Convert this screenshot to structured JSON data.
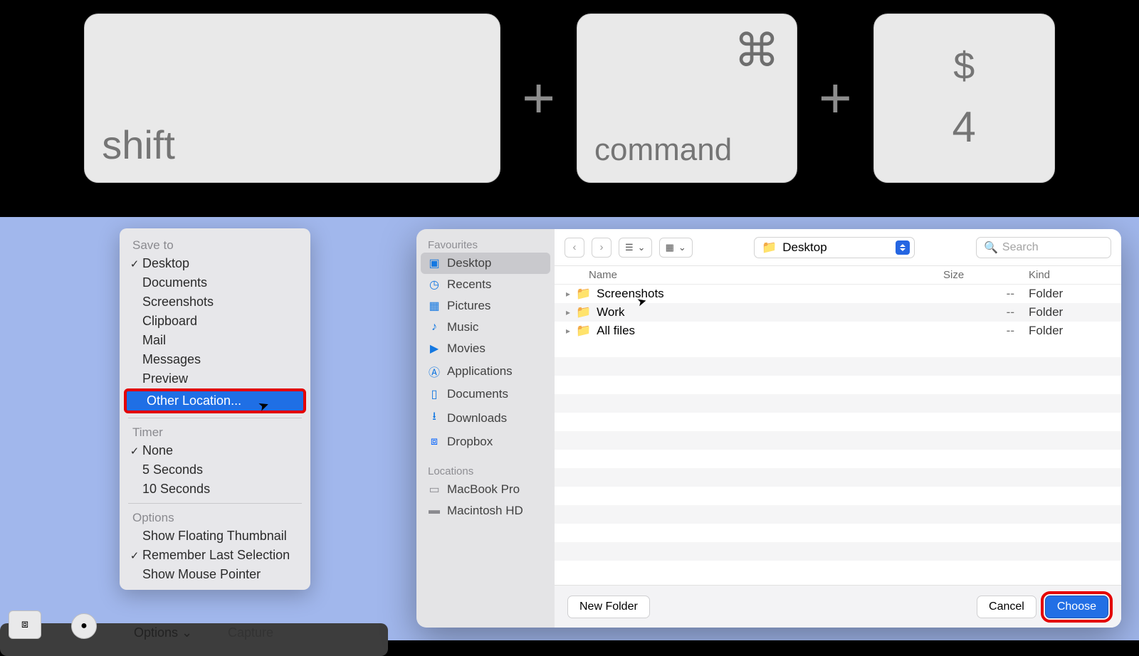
{
  "keys": {
    "shift": "shift",
    "cmd_symbol": "⌘",
    "cmd": "command",
    "dollar": "$",
    "four": "4",
    "plus": "+"
  },
  "menu": {
    "sections": {
      "save_to": "Save to",
      "timer": "Timer",
      "options": "Options"
    },
    "save_items": [
      {
        "label": "Desktop",
        "checked": true
      },
      {
        "label": "Documents",
        "checked": false
      },
      {
        "label": "Screenshots",
        "checked": false
      },
      {
        "label": "Clipboard",
        "checked": false
      },
      {
        "label": "Mail",
        "checked": false
      },
      {
        "label": "Messages",
        "checked": false
      },
      {
        "label": "Preview",
        "checked": false
      },
      {
        "label": "Other Location...",
        "checked": false,
        "highlighted": true
      }
    ],
    "timer_items": [
      {
        "label": "None",
        "checked": true
      },
      {
        "label": "5 Seconds",
        "checked": false
      },
      {
        "label": "10 Seconds",
        "checked": false
      }
    ],
    "option_items": [
      {
        "label": "Show Floating Thumbnail",
        "checked": false
      },
      {
        "label": "Remember Last Selection",
        "checked": true
      },
      {
        "label": "Show Mouse Pointer",
        "checked": false
      }
    ]
  },
  "toolbar": {
    "options": "Options ⌄",
    "capture": "Capture"
  },
  "finder": {
    "sidebar": {
      "fav": "Favourites",
      "items": [
        {
          "icon": "folder",
          "label": "Desktop",
          "selected": true
        },
        {
          "icon": "clock",
          "label": "Recents"
        },
        {
          "icon": "pictures",
          "label": "Pictures"
        },
        {
          "icon": "music",
          "label": "Music"
        },
        {
          "icon": "movies",
          "label": "Movies"
        },
        {
          "icon": "apps",
          "label": "Applications"
        },
        {
          "icon": "doc",
          "label": "Documents"
        },
        {
          "icon": "download",
          "label": "Downloads"
        },
        {
          "icon": "dropbox",
          "label": "Dropbox"
        }
      ],
      "loc": "Locations",
      "loc_items": [
        {
          "icon": "laptop",
          "label": "MacBook Pro"
        },
        {
          "icon": "disk",
          "label": "Macintosh HD"
        }
      ]
    },
    "location": "Desktop",
    "search_placeholder": "Search",
    "cols": {
      "name": "Name",
      "size": "Size",
      "kind": "Kind"
    },
    "rows": [
      {
        "name": "Screenshots",
        "size": "--",
        "kind": "Folder"
      },
      {
        "name": "Work",
        "size": "--",
        "kind": "Folder"
      },
      {
        "name": "All files",
        "size": "--",
        "kind": "Folder"
      }
    ],
    "footer": {
      "new_folder": "New Folder",
      "cancel": "Cancel",
      "choose": "Choose"
    }
  }
}
